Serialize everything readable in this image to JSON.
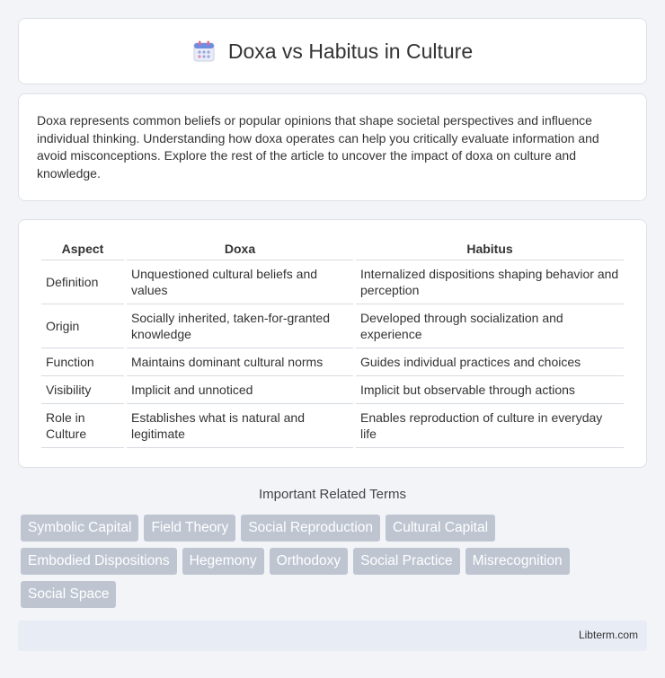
{
  "header": {
    "title": "Doxa vs Habitus in Culture",
    "icon": "calendar-icon"
  },
  "intro": {
    "text": "Doxa represents common beliefs or popular opinions that shape societal perspectives and influence individual thinking. Understanding how doxa operates can help you critically evaluate information and avoid misconceptions. Explore the rest of the article to uncover the impact of doxa on culture and knowledge."
  },
  "table": {
    "headers": [
      "Aspect",
      "Doxa",
      "Habitus"
    ],
    "rows": [
      [
        "Definition",
        "Unquestioned cultural beliefs and values",
        "Internalized dispositions shaping behavior and perception"
      ],
      [
        "Origin",
        "Socially inherited, taken-for-granted knowledge",
        "Developed through socialization and experience"
      ],
      [
        "Function",
        "Maintains dominant cultural norms",
        "Guides individual practices and choices"
      ],
      [
        "Visibility",
        "Implicit and unnoticed",
        "Implicit but observable through actions"
      ],
      [
        "Role in Culture",
        "Establishes what is natural and legitimate",
        "Enables reproduction of culture in everyday life"
      ]
    ]
  },
  "related": {
    "title": "Important Related Terms",
    "tags": [
      "Symbolic Capital",
      "Field Theory",
      "Social Reproduction",
      "Cultural Capital",
      "Embodied Dispositions",
      "Hegemony",
      "Orthodoxy",
      "Social Practice",
      "Misrecognition",
      "Social Space"
    ]
  },
  "footer": {
    "site": "Libterm.com"
  }
}
